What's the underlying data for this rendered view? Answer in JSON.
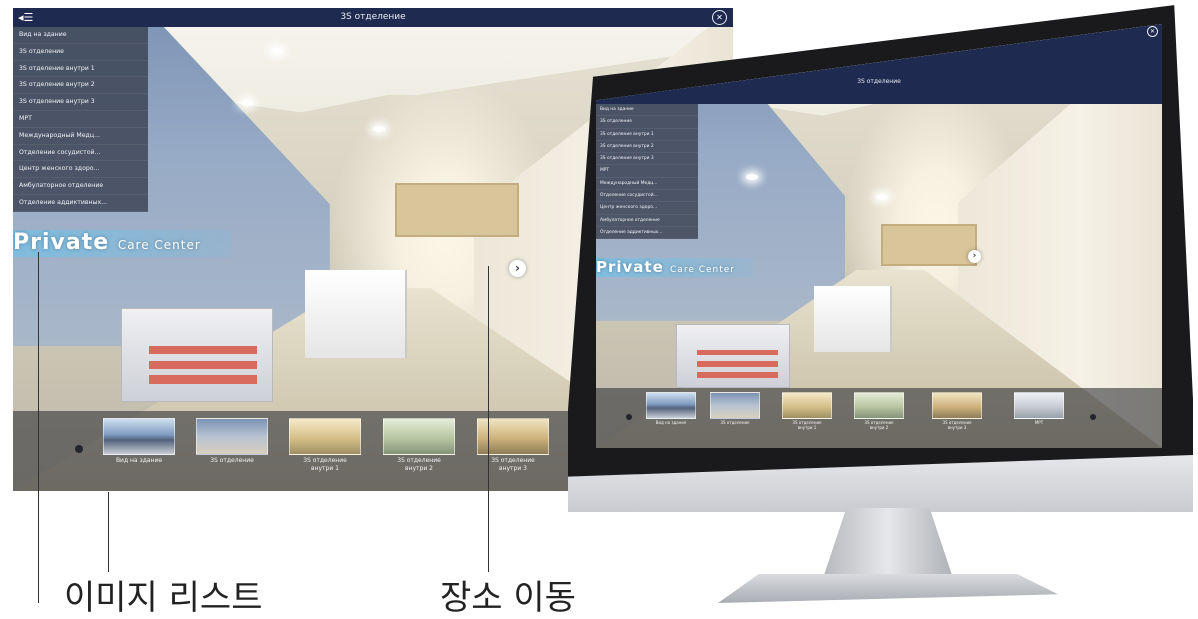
{
  "viewer": {
    "title": "3S отделение",
    "nav_toggle_icon": "◂☰",
    "close_icon": "✕",
    "next_icon": "›",
    "sign_main": "Private",
    "sign_sub": "Care Center",
    "menu": [
      "Вид на здание",
      "3S отделение",
      "3S отделение внутри 1",
      "3S отделение внутри 2",
      "3S отделение внутри 3",
      "МРТ",
      "Международный Медц...",
      "Отделение сосудистой...",
      "Центр женского здоро...",
      "Амбулаторное отделение",
      "Отделение аддиктивных..."
    ],
    "thumbnails": [
      {
        "caption": "Вид на здание"
      },
      {
        "caption": "3S отделение"
      },
      {
        "caption": "3S отделение\nвнутри 1"
      },
      {
        "caption": "3S отделение\nвнутри 2"
      },
      {
        "caption": "3S отделение\nвнутри 3"
      },
      {
        "caption": "МРТ"
      }
    ]
  },
  "callouts": {
    "image_list": "이미지 리스트",
    "move_location": "장소 이동"
  }
}
